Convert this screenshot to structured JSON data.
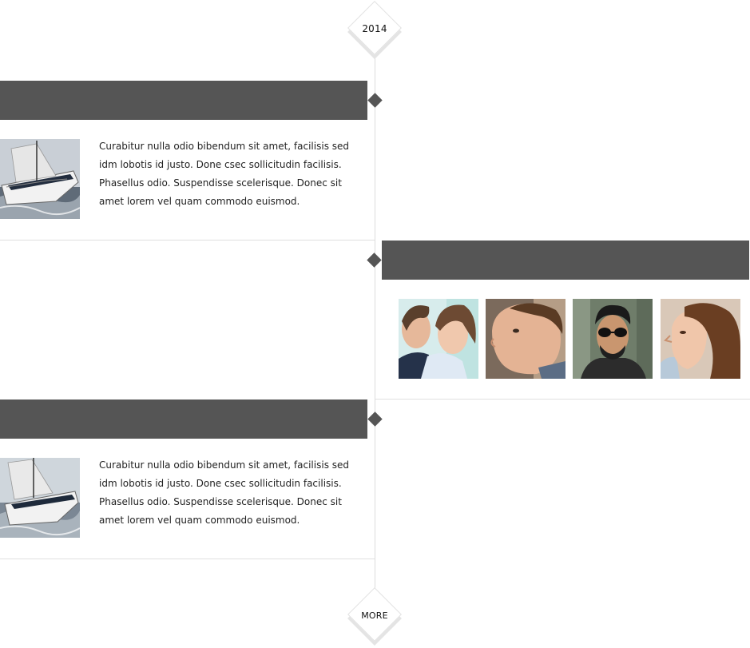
{
  "timeline": {
    "year": "2014",
    "more_label": "MORE",
    "entries": [
      {
        "side": "left",
        "image_icon": "sailboat-photo",
        "text": "Curabitur nulla odio bibendum sit amet, facilisis sed idm lobotis id justo. Done csec sollicitudin facilisis. Phasellus odio. Suspendisse scelerisque. Donec sit amet lorem vel quam commodo euismod."
      },
      {
        "side": "right",
        "gallery": [
          "couple-photo",
          "man-profile-photo",
          "man-sunglasses-photo",
          "woman-profile-photo"
        ]
      },
      {
        "side": "left",
        "image_icon": "sailboat-photo",
        "text": "Curabitur nulla odio bibendum sit amet, facilisis sed idm lobotis id justo. Done csec sollicitudin facilisis. Phasellus odio. Suspendisse scelerisque. Donec sit amet lorem vel quam commodo euismod."
      }
    ]
  },
  "colors": {
    "bar": "#555555",
    "line": "#dcdcdc",
    "node": "#555555"
  }
}
